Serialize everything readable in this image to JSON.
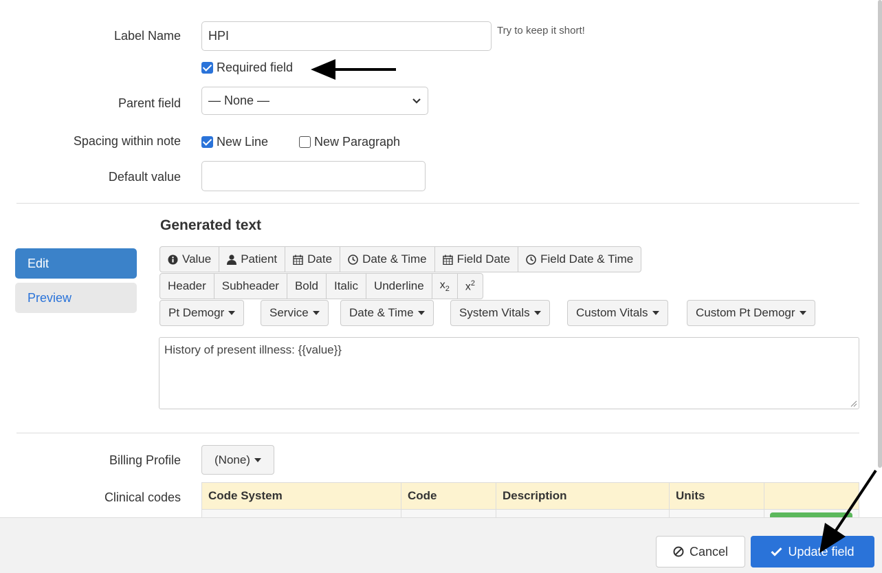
{
  "form": {
    "label_name": {
      "label": "Label Name",
      "value": "HPI",
      "hint": "Try to keep it short!"
    },
    "required": {
      "label": "Required field",
      "checked": true
    },
    "parent": {
      "label": "Parent field",
      "selected": "— None —"
    },
    "spacing": {
      "label": "Spacing within note",
      "new_line": "New Line",
      "new_paragraph": "New Paragraph"
    },
    "default_value": {
      "label": "Default value",
      "value": ""
    }
  },
  "generated": {
    "heading": "Generated text",
    "tabs": {
      "edit": "Edit",
      "preview": "Preview"
    },
    "row1": [
      "Value",
      "Patient",
      "Date",
      "Date & Time",
      "Field Date",
      "Field Date & Time"
    ],
    "row2": [
      "Header",
      "Subheader",
      "Bold",
      "Italic",
      "Underline"
    ],
    "row3": [
      "Pt Demogr",
      "Service",
      "Date & Time",
      "System Vitals",
      "Custom Vitals",
      "Custom Pt Demogr"
    ],
    "template_text": "History of present illness: {{value}}"
  },
  "billing": {
    "label": "Billing Profile",
    "selected": "(None)"
  },
  "clinical": {
    "label": "Clinical codes",
    "columns": [
      "Code System",
      "Code",
      "Description",
      "Units"
    ]
  },
  "footer": {
    "cancel": "Cancel",
    "update": "Update field"
  },
  "colors": {
    "primary": "#2a73d9",
    "add_green": "#5cb85c",
    "table_header": "#fdf3d0"
  }
}
